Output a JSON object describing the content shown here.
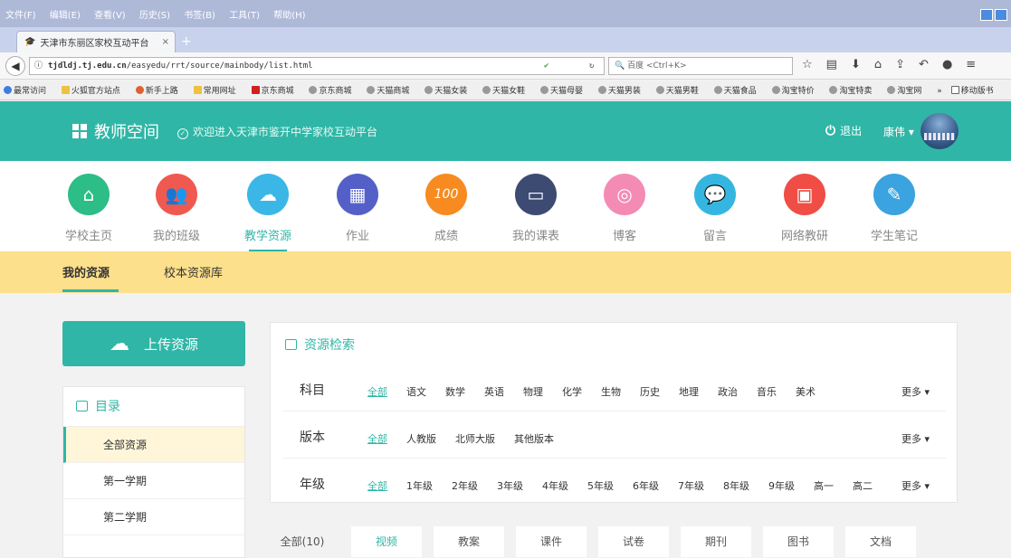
{
  "browser": {
    "menu": [
      "文件(F)",
      "编辑(E)",
      "查看(V)",
      "历史(S)",
      "书签(B)",
      "工具(T)",
      "帮助(H)"
    ],
    "tab_title": "天津市东丽区家校互动平台",
    "tab_close": "×",
    "new_tab": "+",
    "url_host": "tjdldj.tj.edu.cn",
    "url_path": "/easyedu/rrt/source/mainbody/list.html",
    "search_placeholder": "百度 <Ctrl+K>",
    "bookmarks": [
      "最常访问",
      "火狐官方站点",
      "新手上路",
      "常用网址",
      "京东商城",
      "京东商城",
      "天猫商城",
      "天猫女装",
      "天猫女鞋",
      "天猫母婴",
      "天猫男装",
      "天猫男鞋",
      "天猫食品",
      "淘宝特价",
      "淘宝特卖",
      "淘宝网",
      "»",
      "移动版书"
    ]
  },
  "header": {
    "app_title": "教师空间",
    "welcome": "欢迎进入天津市鉴开中学家校互动平台",
    "logout": "退出",
    "username": "康伟"
  },
  "nav": [
    {
      "label": "学校主页",
      "icon": "home-icon",
      "color": "#2dbd86"
    },
    {
      "label": "我的班级",
      "icon": "group-icon",
      "color": "#f0594f"
    },
    {
      "label": "教学资源",
      "icon": "cloud-icon",
      "color": "#3ab7e6"
    },
    {
      "label": "作业",
      "icon": "calendar-icon",
      "color": "#5460c8"
    },
    {
      "label": "成绩",
      "icon": "score-icon",
      "color": "#f78b1f"
    },
    {
      "label": "我的课表",
      "icon": "board-icon",
      "color": "#3d4a72"
    },
    {
      "label": "博客",
      "icon": "blog-icon",
      "color": "#f48bb5"
    },
    {
      "label": "留言",
      "icon": "message-icon",
      "color": "#35b6e0"
    },
    {
      "label": "网络教研",
      "icon": "tv-icon",
      "color": "#ef4d45"
    },
    {
      "label": "学生笔记",
      "icon": "note-icon",
      "color": "#3aa3e0"
    }
  ],
  "subnav": {
    "mine": "我的资源",
    "school": "校本资源库"
  },
  "upload_label": "上传资源",
  "catalog": {
    "title": "目录",
    "items": [
      "全部资源",
      "第一学期",
      "第二学期"
    ]
  },
  "search": {
    "title": "资源检索",
    "rows": [
      {
        "label": "科目",
        "options": [
          "全部",
          "语文",
          "数学",
          "英语",
          "物理",
          "化学",
          "生物",
          "历史",
          "地理",
          "政治",
          "音乐",
          "美术"
        ],
        "more": "更多"
      },
      {
        "label": "版本",
        "options": [
          "全部",
          "人教版",
          "北师大版",
          "其他版本"
        ],
        "more": "更多"
      },
      {
        "label": "年级",
        "options": [
          "全部",
          "1年级",
          "2年级",
          "3年级",
          "4年级",
          "5年级",
          "6年级",
          "7年级",
          "8年级",
          "9年级",
          "高一",
          "高二"
        ],
        "more": "更多"
      }
    ]
  },
  "types": [
    "全部(10)",
    "视频",
    "教案",
    "课件",
    "试卷",
    "期刊",
    "图书",
    "文档"
  ],
  "accent_color": "#2fb6a6"
}
